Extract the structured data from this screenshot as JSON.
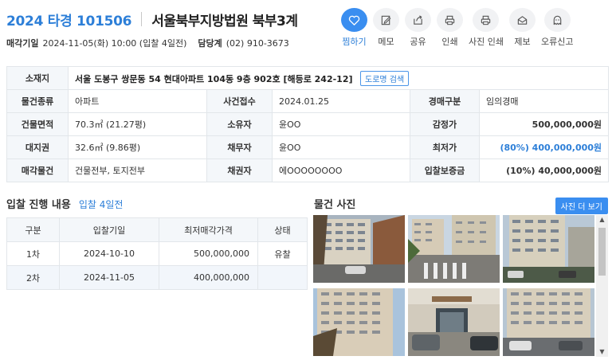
{
  "header": {
    "case_no": "2024 타경 101506",
    "court": "서울북부지방법원 북부3계",
    "sale_date_label": "매각기일",
    "sale_date_value": "2024-11-05(화) 10:00 (입찰 4일전)",
    "manager_label": "담당계",
    "manager_value": "(02) 910-3673"
  },
  "toolbar": {
    "items": [
      {
        "label": "찜하기",
        "icon": "heart-icon"
      },
      {
        "label": "메모",
        "icon": "memo-edit-icon"
      },
      {
        "label": "공유",
        "icon": "share-icon"
      },
      {
        "label": "인쇄",
        "icon": "printer-icon"
      },
      {
        "label": "사진 인쇄",
        "icon": "printer-icon"
      },
      {
        "label": "제보",
        "icon": "report-icon"
      },
      {
        "label": "오류신고",
        "icon": "ghost-icon"
      }
    ]
  },
  "info": {
    "location_label": "소재지",
    "location_value": "서울 도봉구 쌍문동 54 현대아파트 104동 9층 902호 [해등로 242-12]",
    "road_btn": "도로명 검색",
    "rows": [
      [
        {
          "k": "물건종류"
        },
        {
          "v": "아파트"
        },
        {
          "k": "사건접수"
        },
        {
          "v": "2024.01.25"
        },
        {
          "k": "경매구분"
        },
        {
          "v": "임의경매"
        }
      ],
      [
        {
          "k": "건물면적"
        },
        {
          "v": "70.3㎡ (21.27평)"
        },
        {
          "k": "소유자"
        },
        {
          "v": "윤OO"
        },
        {
          "k": "감정가"
        },
        {
          "v": "500,000,000원"
        }
      ],
      [
        {
          "k": "대지권"
        },
        {
          "v": "32.6㎡ (9.86평)"
        },
        {
          "k": "채무자"
        },
        {
          "v": "윤OO"
        },
        {
          "k": "최저가"
        },
        {
          "v": "(80%) 400,000,000원"
        }
      ],
      [
        {
          "k": "매각물건"
        },
        {
          "v": "건물전부, 토지전부"
        },
        {
          "k": "채권자"
        },
        {
          "v": "에OOOOOOOO"
        },
        {
          "k": "입찰보증금"
        },
        {
          "v": "(10%) 40,000,000원"
        }
      ]
    ]
  },
  "bid": {
    "title": "입찰 진행 내용",
    "dday": "입찰 4일전",
    "headers": [
      "구분",
      "입찰기일",
      "최저매각가격",
      "상태"
    ],
    "rows": [
      [
        "1차",
        "2024-10-10",
        "500,000,000",
        "유찰"
      ],
      [
        "2차",
        "2024-11-05",
        "400,000,000",
        ""
      ]
    ]
  },
  "photos": {
    "title": "물건 사진",
    "more_btn": "사진 더 보기"
  },
  "colors": {
    "accent": "#3a8ef0",
    "text_blue": "#2d7fd8"
  }
}
